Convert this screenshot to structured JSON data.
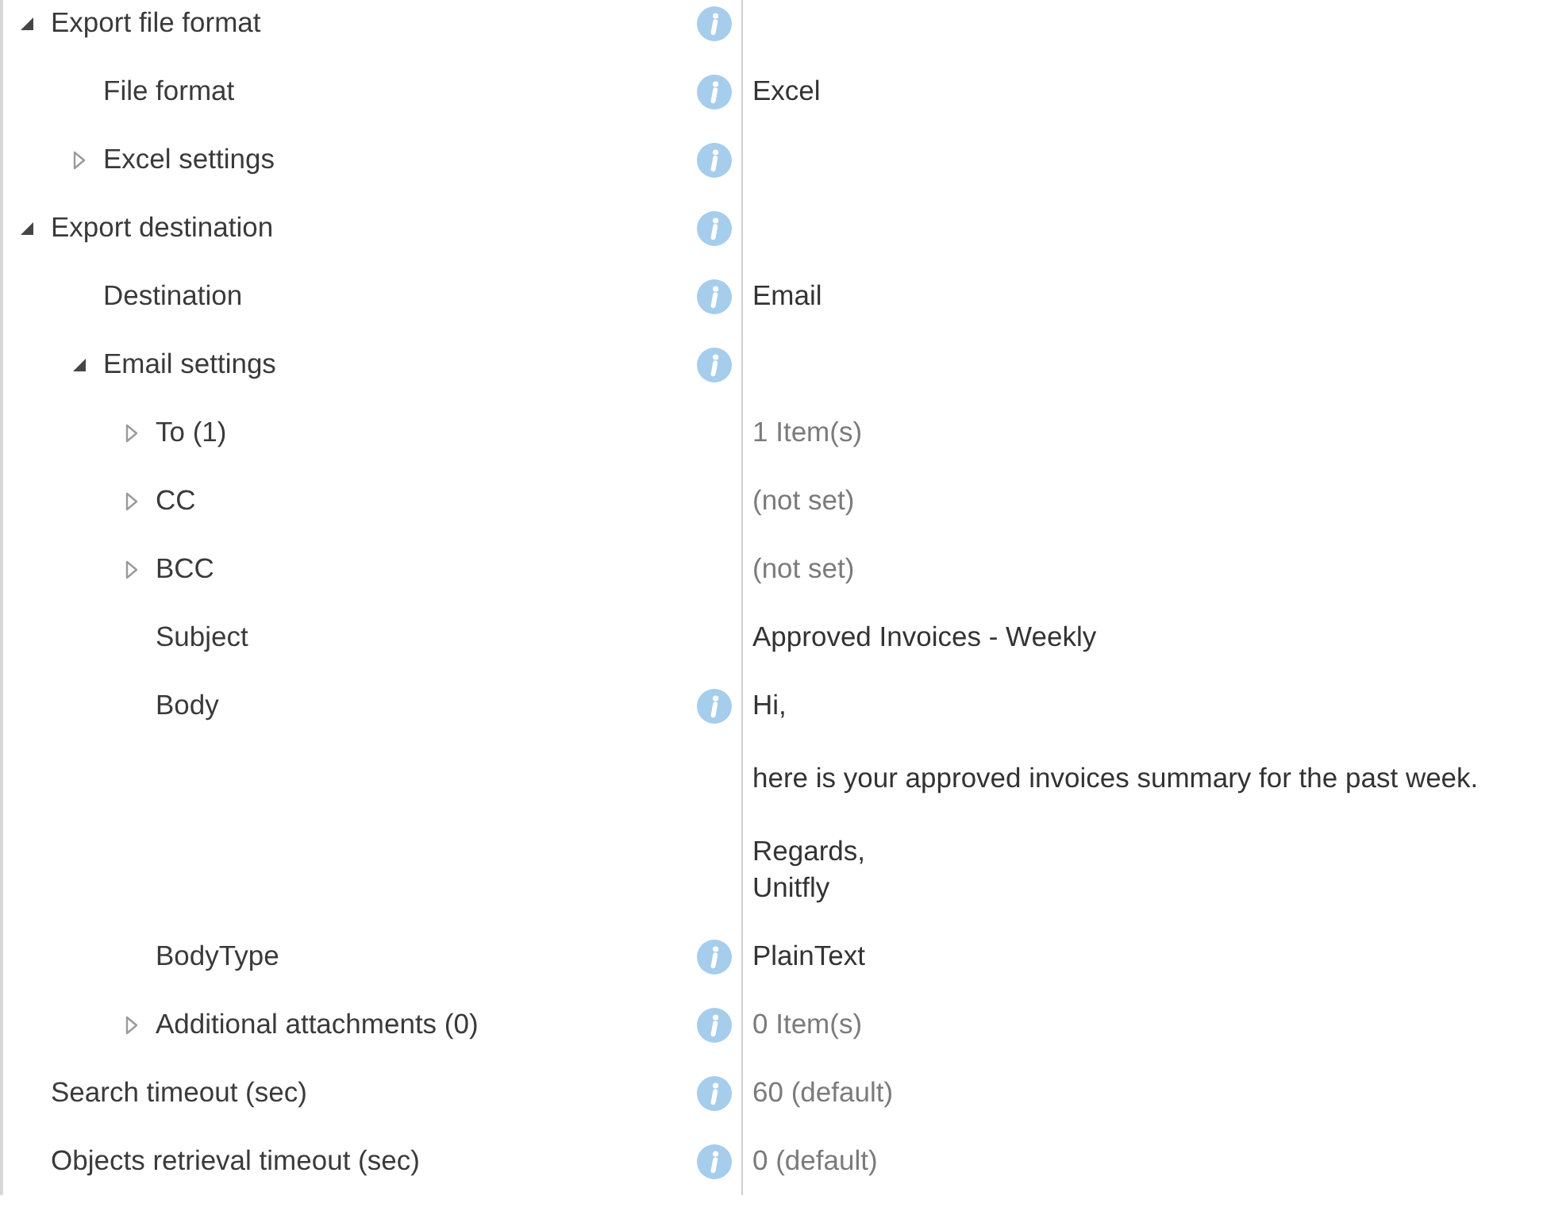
{
  "property_grid": {
    "items": [
      {
        "label": "Export file format",
        "expanded": true,
        "info": true,
        "children": [
          {
            "label": "File format",
            "info": true,
            "value": {
              "text": "Excel",
              "dimmed": false
            }
          },
          {
            "label": "Excel settings",
            "expanded": false,
            "info": true
          }
        ]
      },
      {
        "label": "Export destination",
        "expanded": true,
        "info": true,
        "children": [
          {
            "label": "Destination",
            "info": true,
            "value": {
              "text": "Email",
              "dimmed": false
            }
          },
          {
            "label": "Email settings",
            "expanded": true,
            "info": true,
            "children": [
              {
                "label": "To (1)",
                "expanded": false,
                "info": false,
                "value": {
                  "text": "1 Item(s)",
                  "dimmed": true
                }
              },
              {
                "label": "CC",
                "expanded": false,
                "info": false,
                "value": {
                  "text": "(not set)",
                  "dimmed": true
                }
              },
              {
                "label": "BCC",
                "expanded": false,
                "info": false,
                "value": {
                  "text": "(not set)",
                  "dimmed": true
                }
              },
              {
                "label": "Subject",
                "info": false,
                "value": {
                  "text": "Approved Invoices - Weekly",
                  "dimmed": false
                }
              },
              {
                "label": "Body",
                "info": true,
                "value": {
                  "text": "Hi,\n\nhere is your approved invoices summary for the past week.\n\nRegards,\nUnitfly",
                  "dimmed": false
                }
              },
              {
                "label": "BodyType",
                "info": true,
                "value": {
                  "text": "PlainText",
                  "dimmed": false
                }
              },
              {
                "label": "Additional attachments (0)",
                "expanded": false,
                "info": true,
                "value": {
                  "text": "0 Item(s)",
                  "dimmed": true
                }
              }
            ]
          }
        ]
      },
      {
        "label": "Search timeout (sec)",
        "info": true,
        "value": {
          "text": "60 (default)",
          "dimmed": true
        }
      },
      {
        "label": "Objects retrieval timeout (sec)",
        "info": true,
        "value": {
          "text": "0 (default)",
          "dimmed": true
        }
      }
    ]
  }
}
